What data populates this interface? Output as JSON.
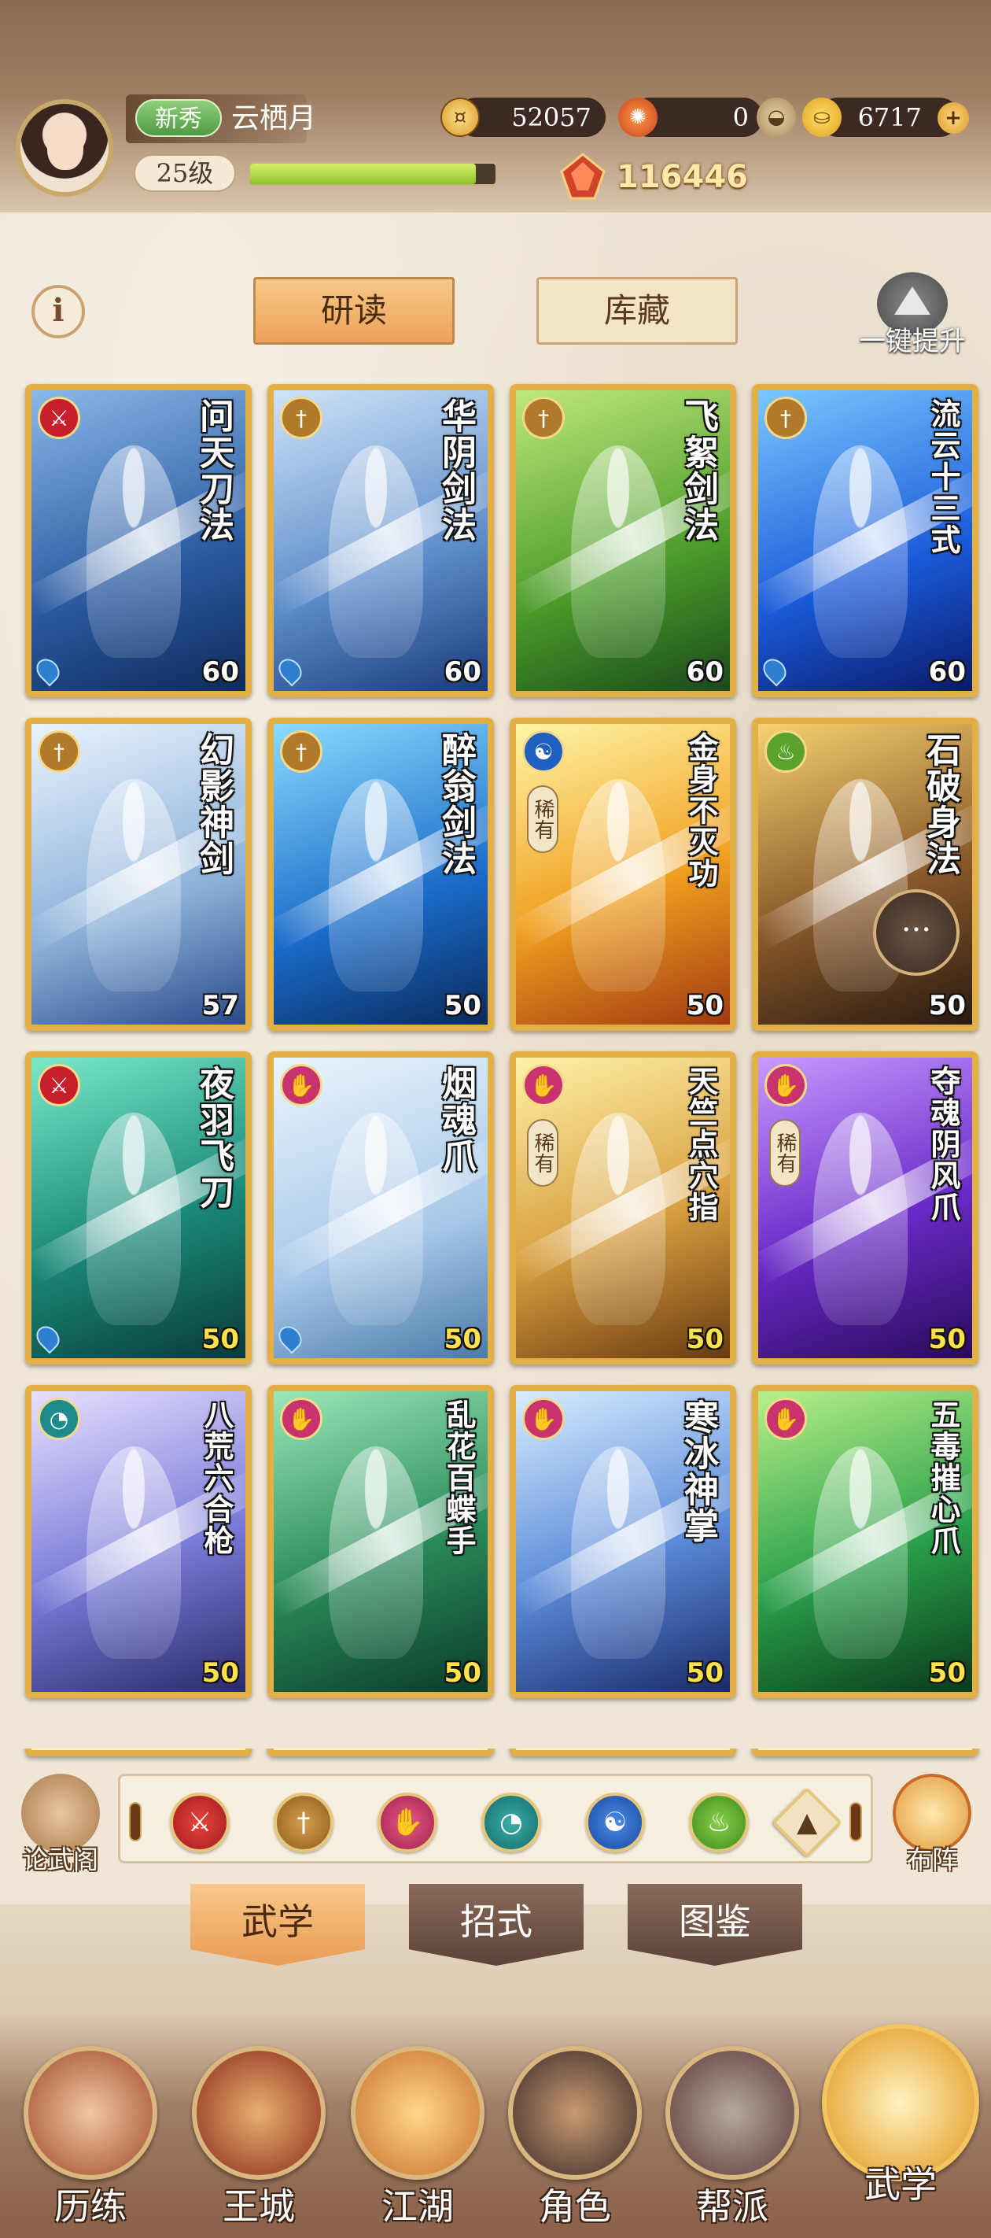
{
  "header": {
    "newbie_badge": "新秀",
    "player_name": "云栖月",
    "level": "25级",
    "exp_fraction": 0.92,
    "copper": "52057",
    "herb": "0",
    "gold": "6717",
    "power": "116446"
  },
  "controls": {
    "info_label": "i",
    "tab_study": "研读",
    "tab_storage": "库藏",
    "one_click_upgrade": "一键提升"
  },
  "cards": [
    {
      "name": "问天刀法",
      "level": "60",
      "type": "blade",
      "rare": false,
      "water": true,
      "level_color": "white"
    },
    {
      "name": "华阴剑法",
      "level": "60",
      "type": "sword",
      "rare": false,
      "water": true,
      "level_color": "white"
    },
    {
      "name": "飞絮剑法",
      "level": "60",
      "type": "sword",
      "rare": false,
      "water": false,
      "level_color": "white"
    },
    {
      "name": "流云十三式",
      "level": "60",
      "type": "sword",
      "rare": false,
      "water": true,
      "level_color": "white"
    },
    {
      "name": "幻影神剑",
      "level": "57",
      "type": "sword",
      "rare": false,
      "water": false,
      "level_color": "white"
    },
    {
      "name": "醉翁剑法",
      "level": "50",
      "type": "sword",
      "rare": false,
      "water": false,
      "level_color": "white"
    },
    {
      "name": "金身不灭功",
      "level": "50",
      "type": "internal",
      "rare": true,
      "water": false,
      "level_color": "white"
    },
    {
      "name": "石破身法",
      "level": "50",
      "type": "movement",
      "rare": false,
      "water": false,
      "level_color": "white"
    },
    {
      "name": "夜羽飞刀",
      "level": "50",
      "type": "blade",
      "rare": false,
      "water": true,
      "level_color": "yellow"
    },
    {
      "name": "烟魂爪",
      "level": "50",
      "type": "fist",
      "rare": false,
      "water": true,
      "level_color": "yellow"
    },
    {
      "name": "天竺点穴指",
      "level": "50",
      "type": "fist",
      "rare": true,
      "water": false,
      "level_color": "yellow"
    },
    {
      "name": "夺魂阴风爪",
      "level": "50",
      "type": "fist",
      "rare": true,
      "water": false,
      "level_color": "yellow"
    },
    {
      "name": "八荒六合枪",
      "level": "50",
      "type": "fan",
      "rare": false,
      "water": false,
      "level_color": "yellow"
    },
    {
      "name": "乱花百蝶手",
      "level": "50",
      "type": "fist",
      "rare": false,
      "water": false,
      "level_color": "yellow"
    },
    {
      "name": "寒冰神掌",
      "level": "50",
      "type": "fist",
      "rare": false,
      "water": false,
      "level_color": "yellow"
    },
    {
      "name": "五毒摧心爪",
      "level": "50",
      "type": "fist",
      "rare": false,
      "water": false,
      "level_color": "yellow"
    }
  ],
  "rare_label": "稀有",
  "filters": {
    "left_button": "论武阁",
    "right_button": "布阵",
    "icons": [
      "blade-filter-icon",
      "sword-filter-icon",
      "fist-filter-icon",
      "fan-filter-icon",
      "internal-filter-icon",
      "movement-filter-icon",
      "up-filter-icon"
    ]
  },
  "subtabs": {
    "martial": "武学",
    "moves": "招式",
    "atlas": "图鉴"
  },
  "nav": {
    "training": "历练",
    "city": "王城",
    "jianghu": "江湖",
    "character": "角色",
    "guild": "帮派",
    "martial": "武学"
  },
  "colors": {
    "blade": "#c8202a",
    "sword": "#b07a2a",
    "fist": "#c8336e",
    "fan": "#1e8b8b",
    "internal": "#1f5fc0",
    "movement": "#5aa22a",
    "gold_frame": "#e2b046"
  }
}
